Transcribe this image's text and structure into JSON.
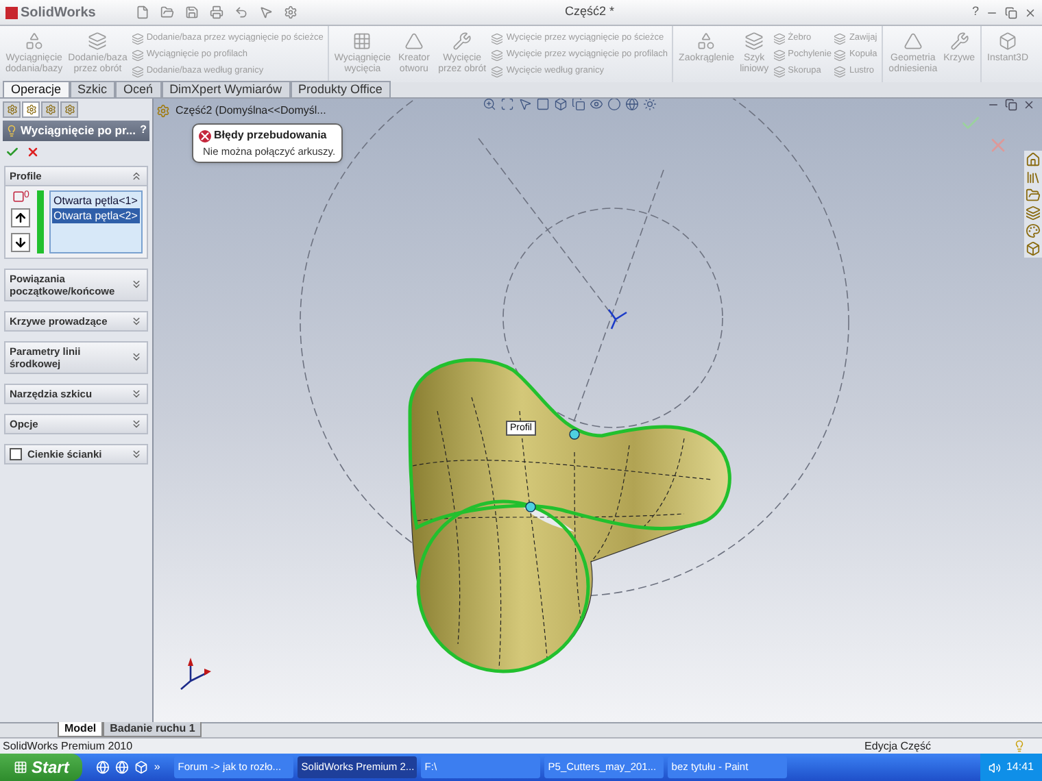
{
  "window": {
    "app_name": "SolidWorks",
    "title": "Część2 *",
    "help": "?"
  },
  "ribbon": {
    "disabled": true,
    "groups": [
      {
        "columns": [
          {
            "kind": "large",
            "label": "Wyciągnięcie dodania/bazy"
          },
          {
            "kind": "large",
            "label": "Dodanie/baza przez obrót"
          },
          {
            "kind": "stack",
            "items": [
              "Dodanie/baza przez wyciągnięcie po ścieżce",
              "Wyciągnięcie po profilach",
              "Dodanie/baza według granicy"
            ]
          }
        ]
      },
      {
        "columns": [
          {
            "kind": "large",
            "label": "Wyciągnięcie wycięcia"
          },
          {
            "kind": "large",
            "label": "Kreator otworu"
          },
          {
            "kind": "large",
            "label": "Wycięcie przez obrót"
          },
          {
            "kind": "stack",
            "items": [
              "Wycięcie przez wyciągnięcie po ścieżce",
              "Wycięcie przez wyciągnięcie po profilach",
              "Wycięcie według granicy"
            ]
          }
        ]
      },
      {
        "columns": [
          {
            "kind": "large",
            "label": "Zaokrąglenie"
          },
          {
            "kind": "large",
            "label": "Szyk liniowy"
          },
          {
            "kind": "stack",
            "items": [
              "Żebro",
              "Pochylenie",
              "Skorupa"
            ]
          },
          {
            "kind": "stack",
            "items": [
              "Zawijaj",
              "Kopuła",
              "Lustro"
            ]
          }
        ]
      },
      {
        "columns": [
          {
            "kind": "large",
            "label": "Geometria odniesienia"
          },
          {
            "kind": "large",
            "label": "Krzywe"
          }
        ]
      },
      {
        "columns": [
          {
            "kind": "large",
            "label": "Instant3D"
          }
        ]
      }
    ]
  },
  "command_tabs": [
    {
      "label": "Operacje",
      "selected": true
    },
    {
      "label": "Szkic",
      "selected": false
    },
    {
      "label": "Oceń",
      "selected": false
    },
    {
      "label": "DimXpert Wymiarów",
      "selected": false
    },
    {
      "label": "Produkty Office",
      "selected": false
    }
  ],
  "panel": {
    "tabs": [
      {
        "selected": false
      },
      {
        "selected": true
      },
      {
        "selected": false
      },
      {
        "selected": false
      }
    ],
    "title": "Wyciągnięcie po pr...",
    "help": "?",
    "sections": [
      {
        "kind": "list",
        "title": "Profile",
        "expanded": true,
        "badge": "0",
        "items": [
          {
            "label": "Otwarta pętla<1>",
            "selected": false
          },
          {
            "label": "Otwarta pętla<2>",
            "selected": true
          }
        ]
      },
      {
        "kind": "plain",
        "title": "Powiązania początkowe/końcowe",
        "expanded": false
      },
      {
        "kind": "plain",
        "title": "Krzywe prowadzące",
        "expanded": false
      },
      {
        "kind": "plain",
        "title": "Parametry linii środkowej",
        "expanded": false
      },
      {
        "kind": "plain",
        "title": "Narzędzia szkicu",
        "expanded": false
      },
      {
        "kind": "plain",
        "title": "Opcje",
        "expanded": false
      },
      {
        "kind": "checkbox",
        "title": "Cienkie ścianki",
        "checked": false,
        "expanded": false
      }
    ]
  },
  "viewport": {
    "tree_item": "Część2  (Domyślna<<Domyśl...",
    "error": {
      "title": "Błędy przebudowania",
      "message": "Nie można połączyć arkuszy."
    },
    "sketch_label": "Profil"
  },
  "bottom_tabs": [
    {
      "label": "Model",
      "selected": true
    },
    {
      "label": "Badanie ruchu 1",
      "selected": false
    }
  ],
  "status_bar": {
    "product": "SolidWorks Premium 2010",
    "mode": "Edycja Część"
  },
  "taskbar": {
    "start": "Start",
    "more": "»",
    "tasks": [
      {
        "label": "Forum -> jak to rozło...",
        "selected": false
      },
      {
        "label": "SolidWorks Premium 2...",
        "selected": true
      },
      {
        "label": "F:\\",
        "selected": false
      },
      {
        "label": "P5_Cutters_may_201...",
        "selected": false
      },
      {
        "label": "bez tytułu - Paint",
        "selected": false
      }
    ],
    "clock": "14:41"
  }
}
